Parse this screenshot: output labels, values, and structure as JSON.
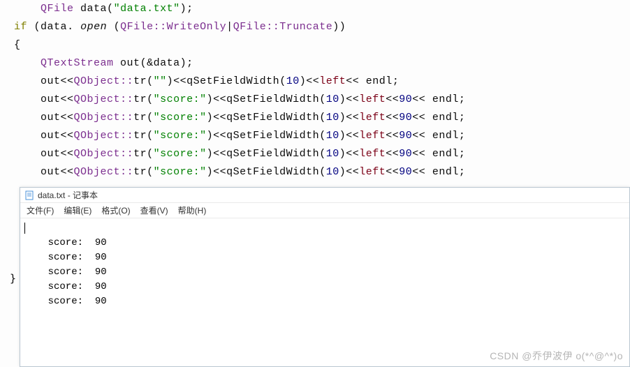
{
  "code": {
    "indent1": "    ",
    "indent2": "        ",
    "l1_qfile": "QFile",
    "l1_var": " data",
    "l1_str": "\"data.txt\"",
    "l2_if": "if",
    "l2_var": "data",
    "l2_open": "open",
    "l2_qfile1": "QFile",
    "l2_wonly": "WriteOnly",
    "l2_qfile2": "QFile",
    "l2_trunc": "Truncate",
    "l4_qts": "QTextStream",
    "l4_out": " out",
    "l4_ref": "&data",
    "out": "out",
    "qobj": "QObject",
    "tr": "tr",
    "str_empty": "\"\"",
    "str_score": "\"score:\"",
    "qsfw": "qSetFieldWidth",
    "n10": "10",
    "left": "left",
    "n90": "90",
    "endl": "endl",
    "dcolon": "::",
    "larr": "<<",
    "semi": ";",
    "pipe": "|",
    "dot": ". ",
    "op": "(",
    "cp": ")",
    "ob": "{",
    "cb": "}"
  },
  "notepad": {
    "title": "data.txt - 记事本",
    "menu": {
      "file": "文件(F)",
      "edit": "编辑(E)",
      "format": "格式(O)",
      "view": "查看(V)",
      "help": "帮助(H)"
    },
    "content_line": "    score:  90",
    "close_brace": "}"
  },
  "watermark": "CSDN @乔伊波伊 o(*^@^*)o"
}
